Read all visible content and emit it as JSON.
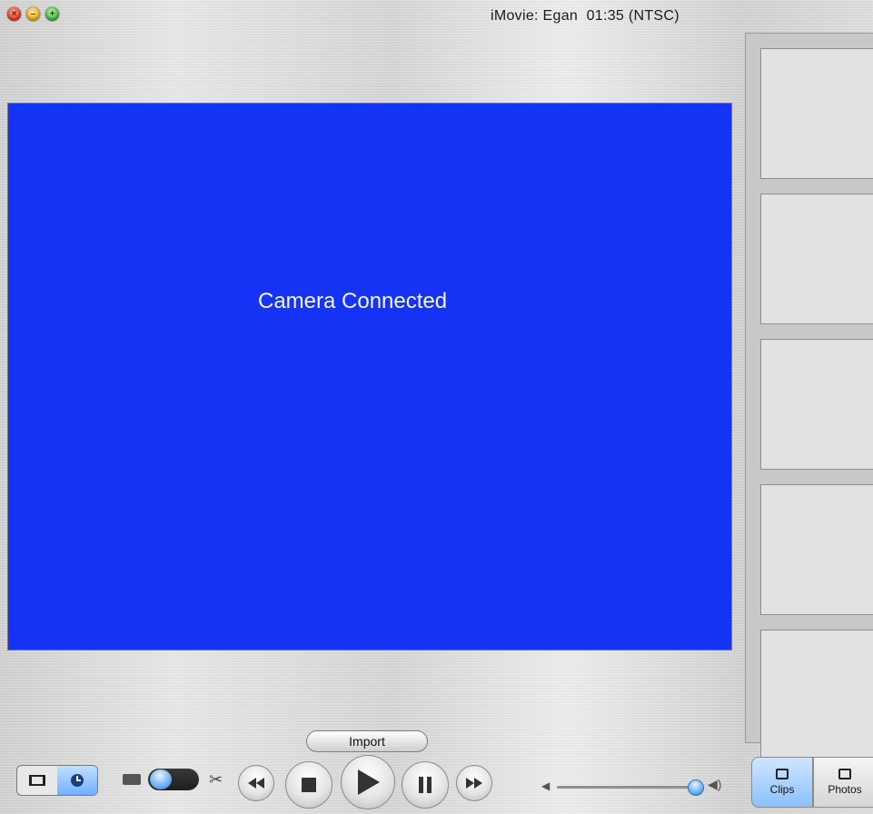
{
  "window": {
    "title": "iMovie: Egan  01:35 (NTSC)"
  },
  "traffic_lights": {
    "close_icon": "close-icon",
    "minimize_icon": "minimize-icon",
    "zoom_icon": "zoom-icon"
  },
  "viewer": {
    "message": "Camera Connected",
    "background_color": "#1533f5"
  },
  "clip_shelf": {
    "empty_slots": 5
  },
  "controls": {
    "import_label": "Import",
    "mode": "camera"
  },
  "volume": {
    "level": 0.95
  },
  "pane_tabs": [
    {
      "label": "Clips",
      "selected": true
    },
    {
      "label": "Photos",
      "selected": false
    }
  ]
}
